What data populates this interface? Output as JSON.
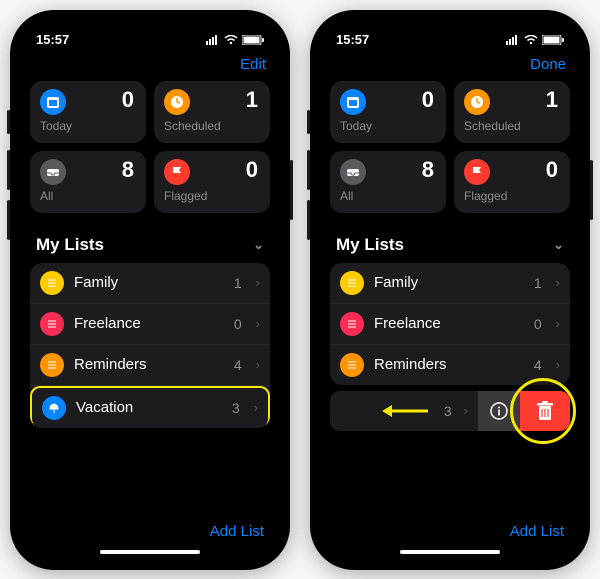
{
  "status_time": "15:57",
  "right_button_a": "Edit",
  "right_button_b": "Done",
  "summary": [
    {
      "label": "Today",
      "count": "0"
    },
    {
      "label": "Scheduled",
      "count": "1"
    },
    {
      "label": "All",
      "count": "8"
    },
    {
      "label": "Flagged",
      "count": "0"
    }
  ],
  "section_title": "My Lists",
  "lists": [
    {
      "name": "Family",
      "count": "1"
    },
    {
      "name": "Freelance",
      "count": "0"
    },
    {
      "name": "Reminders",
      "count": "4"
    },
    {
      "name": "Vacation",
      "count": "3"
    }
  ],
  "swipe_row_count": "3",
  "add_list": "Add List"
}
